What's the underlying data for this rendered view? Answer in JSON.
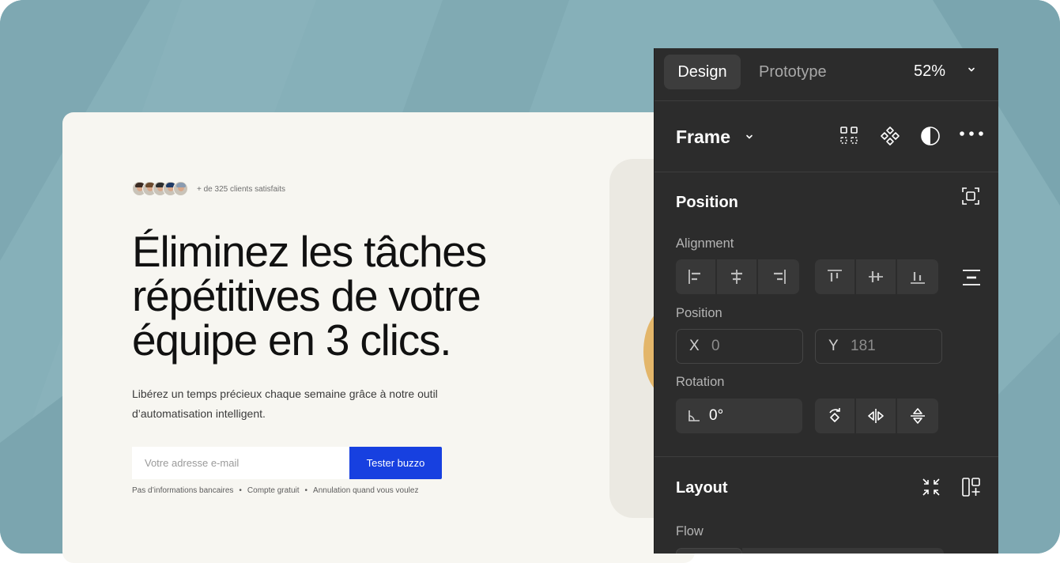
{
  "landing": {
    "clients_text": "+ de 325 clients satisfaits",
    "hero_title_line1": "Éliminez les tâches",
    "hero_title_line2": "répétitives de votre",
    "hero_title_line3": "équipe en 3 clics.",
    "hero_sub_line1": "Libérez un temps précieux chaque semaine grâce à notre outil",
    "hero_sub_line2": "d’automatisation intelligent.",
    "email_placeholder": "Votre adresse e-mail",
    "cta_label": "Tester buzzo",
    "perks": [
      "Pas d’informations bancaires",
      "Compte gratuit",
      "Annulation quand vous voulez"
    ],
    "perk_separator": "•",
    "avatars": [
      {
        "hair": "#3a2a22"
      },
      {
        "hair": "#6b4a2e"
      },
      {
        "hair": "#2d2d2d"
      },
      {
        "hair": "#1f3a66"
      },
      {
        "hair": "#8a9bb0"
      }
    ]
  },
  "panel": {
    "tabs": {
      "design": "Design",
      "prototype": "Prototype"
    },
    "zoom": "52%",
    "frame": {
      "label": "Frame",
      "icons": [
        "grid-icon",
        "component-icon",
        "contrast-icon",
        "more-icon"
      ]
    },
    "position_section": {
      "title": "Position",
      "alignment_label": "Alignment",
      "position_label": "Position",
      "x_label": "X",
      "x_value": "0",
      "y_label": "Y",
      "y_value": "181",
      "rotation_label": "Rotation",
      "rotation_value": "0°"
    },
    "layout_section": {
      "title": "Layout",
      "flow_label": "Flow"
    }
  },
  "colors": {
    "background": "#86b0b9",
    "card": "#f7f6f1",
    "accent": "#1740e0",
    "panel": "#2c2c2c",
    "deco_circle": "#e3b66a"
  }
}
